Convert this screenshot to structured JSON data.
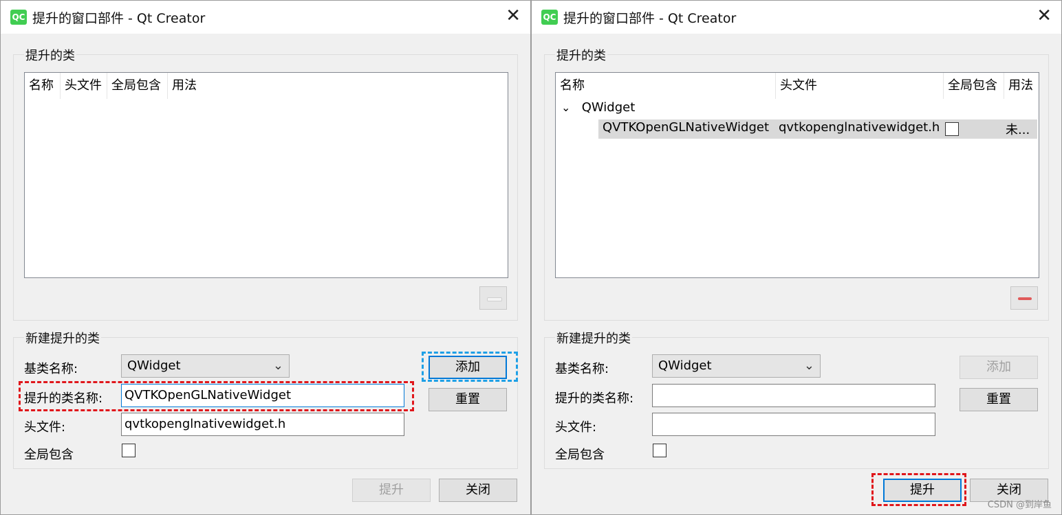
{
  "left_dialog": {
    "title": "提升的窗口部件 - Qt Creator",
    "icon_text": "QC",
    "promoted_group_title": "提升的类",
    "columns": [
      "名称",
      "头文件",
      "全局包含",
      "用法"
    ],
    "new_group_title": "新建提升的类",
    "base_class_label": "基类名称:",
    "base_class_value": "QWidget",
    "promoted_name_label": "提升的类名称:",
    "promoted_name_value": "QVTKOpenGLNativeWidget",
    "header_label": "头文件:",
    "header_value": "qvtkopenglnativewidget.h",
    "global_include_label": "全局包含",
    "add_button": "添加",
    "reset_button": "重置",
    "promote_button": "提升",
    "close_button": "关闭"
  },
  "right_dialog": {
    "title": "提升的窗口部件 - Qt Creator",
    "icon_text": "QC",
    "promoted_group_title": "提升的类",
    "columns": [
      "名称",
      "头文件",
      "全局包含",
      "用法"
    ],
    "tree": {
      "parent": "QWidget",
      "child_name": "QVTKOpenGLNativeWidget",
      "child_header": "qvtkopenglnativewidget.h",
      "child_usage": "未..."
    },
    "new_group_title": "新建提升的类",
    "base_class_label": "基类名称:",
    "base_class_value": "QWidget",
    "promoted_name_label": "提升的类名称:",
    "promoted_name_value": "",
    "header_label": "头文件:",
    "header_value": "",
    "global_include_label": "全局包含",
    "add_button": "添加",
    "reset_button": "重置",
    "promote_button": "提升",
    "close_button": "关闭"
  },
  "watermark": "CSDN @到岸鱼",
  "colors": {
    "highlight_red": "#e0161b",
    "highlight_blue": "#1ea0e6",
    "qt_green": "#41cd52",
    "remove_red": "#e05a5a"
  }
}
